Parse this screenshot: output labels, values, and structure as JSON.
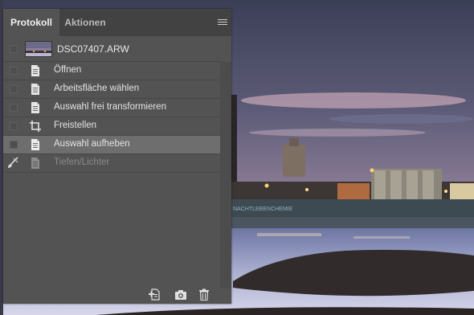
{
  "tabs": [
    {
      "label": "Protokoll",
      "active": true
    },
    {
      "label": "Aktionen",
      "active": false
    }
  ],
  "snapshot": {
    "name": "DSC07407.ARW"
  },
  "history": [
    {
      "label": "Öffnen",
      "icon": "document-icon",
      "selected": false,
      "inactive": false
    },
    {
      "label": "Arbeitsfläche wählen",
      "icon": "document-icon",
      "selected": false,
      "inactive": false
    },
    {
      "label": "Auswahl frei transformieren",
      "icon": "document-icon",
      "selected": false,
      "inactive": false
    },
    {
      "label": "Freistellen",
      "icon": "crop-icon",
      "selected": false,
      "inactive": false
    },
    {
      "label": "Auswahl aufheben",
      "icon": "document-icon",
      "selected": true,
      "inactive": false
    },
    {
      "label": "Tiefen/Lichter",
      "icon": "document-icon",
      "selected": false,
      "inactive": true
    }
  ],
  "footer_icons": [
    "new-document-from-state-icon",
    "camera-icon",
    "trash-icon"
  ],
  "photo_sign": "NACHTLEBENCHEMIE",
  "colors": {
    "panel": "#535353",
    "tabbar": "#424242",
    "selected_row": "#6e6e6e"
  }
}
